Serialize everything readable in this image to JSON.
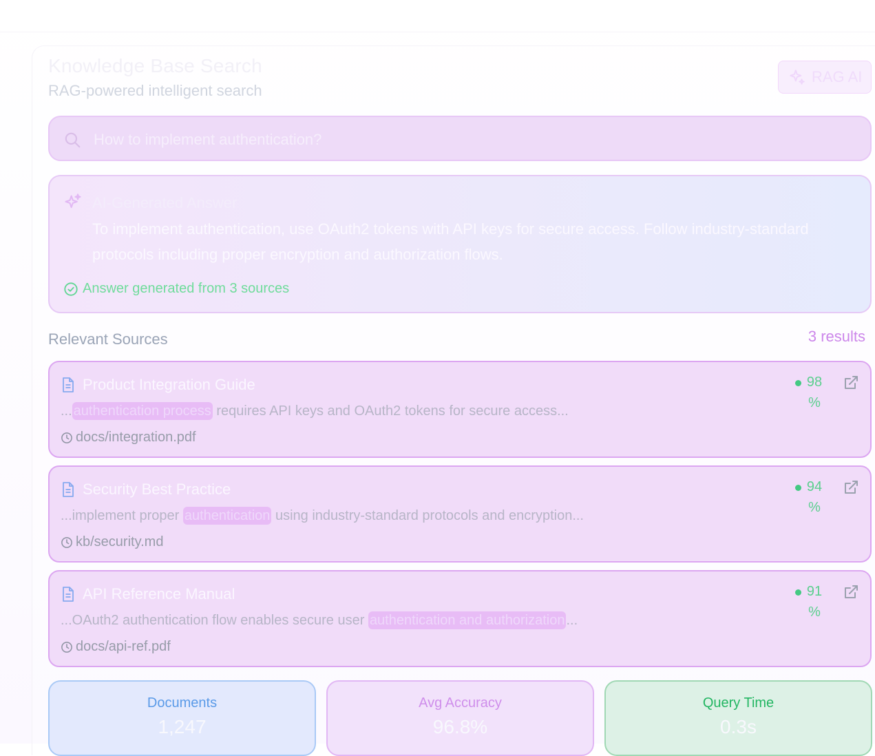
{
  "header": {
    "title": "Knowledge Base Search",
    "subtitle": "RAG-powered intelligent search",
    "badge_label": "RAG AI"
  },
  "search": {
    "value": "How to implement authentication?"
  },
  "answer": {
    "heading": "AI-Generated Answer",
    "body": "To implement authentication, use OAuth2 tokens with API keys for secure access. Follow industry-standard protocols including proper encryption and authorization flows.",
    "footer": "Answer generated from 3 sources"
  },
  "sources": {
    "label": "Relevant Sources",
    "count_label": "3 results",
    "items": [
      {
        "title": "Product Integration Guide",
        "snippet_before": "...",
        "highlight": "authentication process",
        "snippet_after": " requires API keys and OAuth2 tokens for secure access...",
        "path": "docs/integration.pdf",
        "score": "98",
        "score_unit": "%"
      },
      {
        "title": "Security Best Practice",
        "snippet_before": "...implement proper ",
        "highlight": "authentication",
        "snippet_after": " using industry-standard protocols and encryption...",
        "path": "kb/security.md",
        "score": "94",
        "score_unit": "%"
      },
      {
        "title": "API Reference Manual",
        "snippet_before": "...OAuth2 authentication flow enables secure user ",
        "highlight": "authentication and authorization",
        "snippet_after": "...",
        "path": "docs/api-ref.pdf",
        "score": "91",
        "score_unit": "%"
      }
    ]
  },
  "stats": {
    "documents": {
      "label": "Documents",
      "value": "1,247"
    },
    "accuracy": {
      "label": "Avg Accuracy",
      "value": "96.8%"
    },
    "query_time": {
      "label": "Query Time",
      "value": "0.3s"
    }
  },
  "colors": {
    "accent_purple": "#cc86ea",
    "success_green": "#44c983",
    "info_blue": "#5a9ae8"
  },
  "icons": {
    "search": "search-icon",
    "sparkles": "sparkles-icon",
    "check": "check-circle-icon",
    "document": "document-icon",
    "clock": "clock-icon",
    "external": "external-link-icon"
  }
}
